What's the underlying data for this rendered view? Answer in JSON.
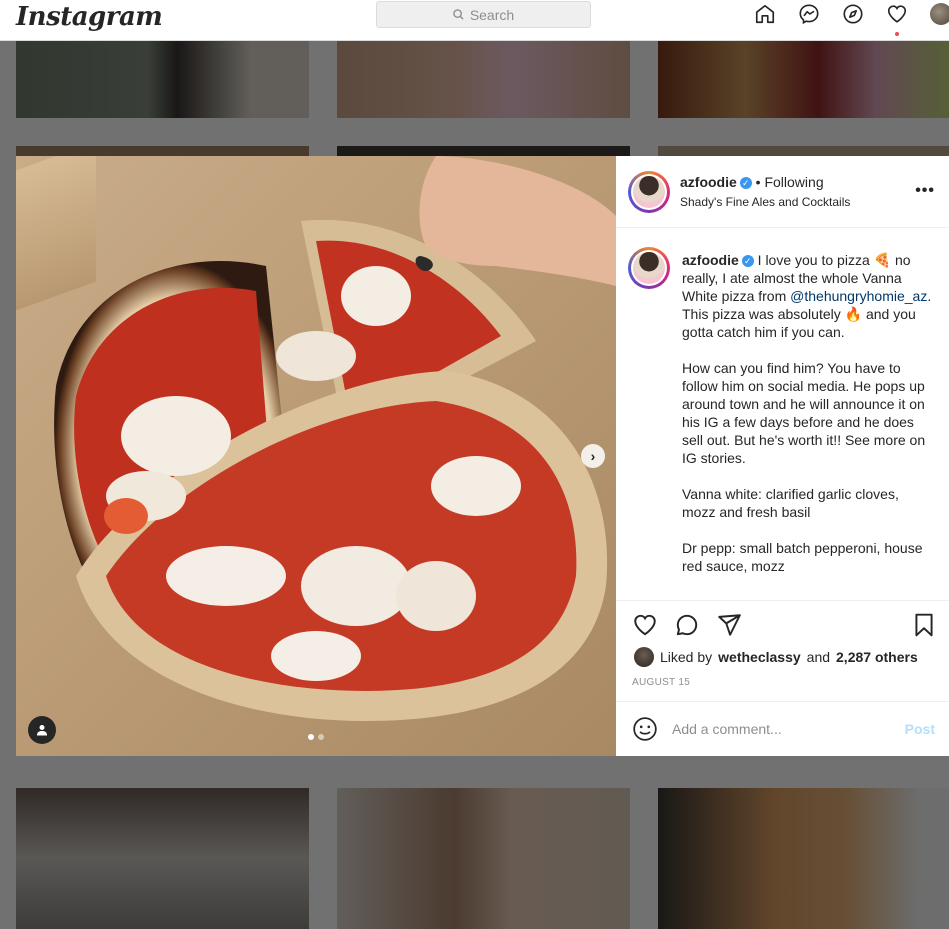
{
  "nav": {
    "logo": "Instagram",
    "search_placeholder": "Search"
  },
  "post": {
    "username": "azfoodie",
    "follow_status": "• Following",
    "location": "Shady's Fine Ales and Cocktails",
    "caption_paragraphs": [
      "How can you find him? You have to follow him on social media. He pops up around town and he will announce it on his IG a few days before and he does sell out. But he's worth it!! See more on IG stories.",
      "Vanna white: clarified garlic cloves, mozz and fresh basil",
      "Dr pepp: small batch pepperoni, house red sauce, mozz"
    ],
    "caption_intro_1": "I love you to pizza 🍕 no really, I ate almost the whole Vanna White pizza from",
    "mention": "@thehungryhomie_az",
    "caption_intro_2": ". This pizza was absolutely 🔥 and you gotta catch him if you can.",
    "liked_prefix": "Liked by",
    "liked_user": "wetheclassy",
    "liked_and": "and",
    "liked_others": "2,287 others",
    "date": "AUGUST 15",
    "comment_placeholder": "Add a comment...",
    "post_label": "Post",
    "carousel_next": "›",
    "more": "•••"
  },
  "colors": {
    "accent_blue": "#3897f0",
    "post_disabled": "#b2dffc",
    "notification_red": "#ed4956"
  },
  "icons": [
    "home-icon",
    "messenger-icon",
    "explore-icon",
    "heart-icon",
    "like-icon",
    "comment-icon",
    "share-icon",
    "bookmark-icon",
    "emoji-icon",
    "user-tag-icon",
    "search-icon"
  ]
}
